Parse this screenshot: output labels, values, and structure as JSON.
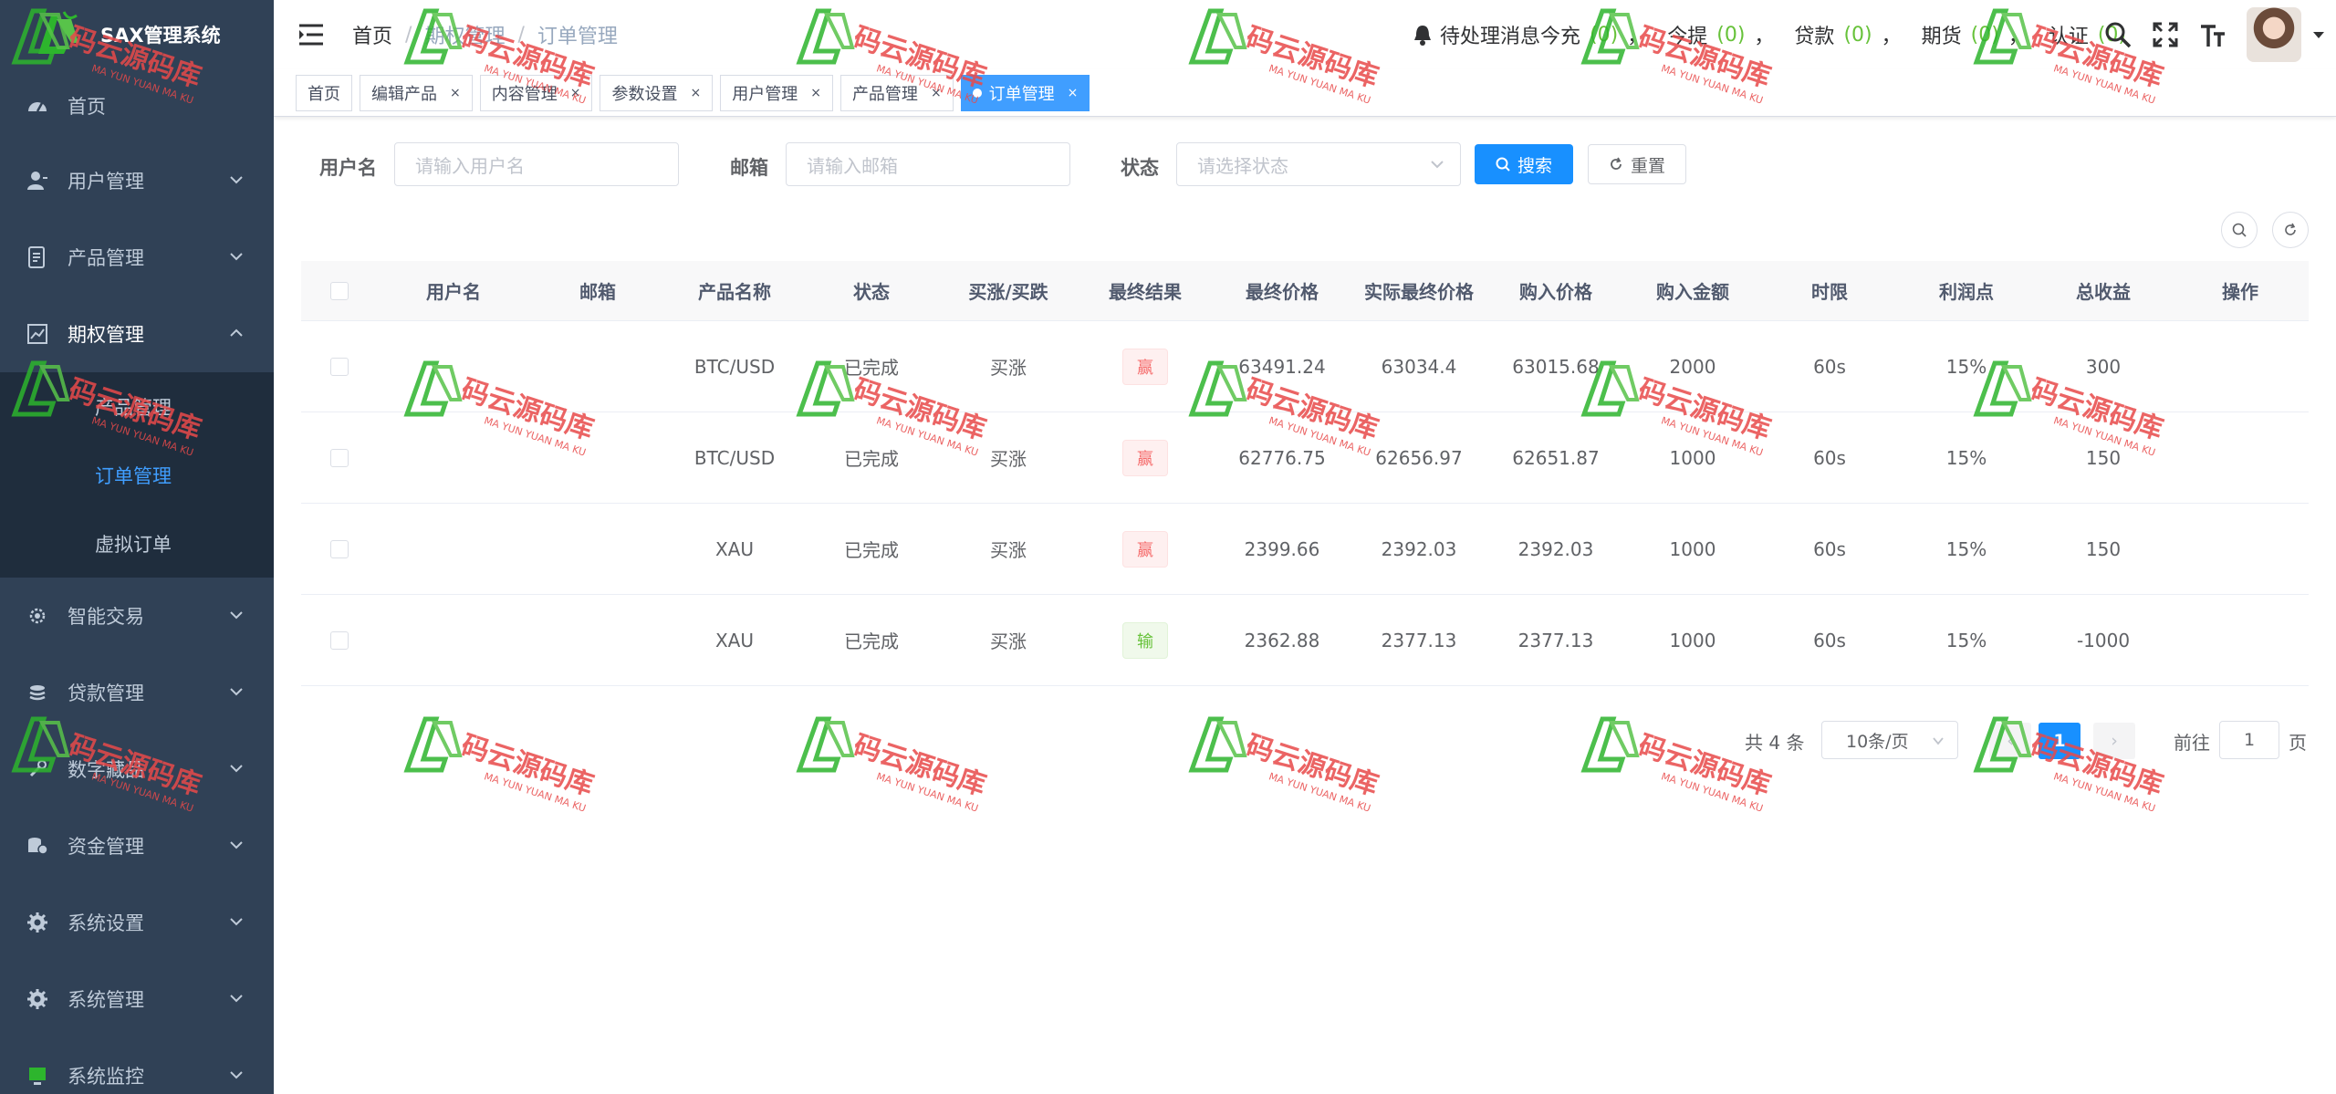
{
  "app": {
    "title": "SAX管理系统"
  },
  "sidebar": {
    "items": [
      {
        "label": "首页",
        "icon": "dashboard-icon"
      },
      {
        "label": "用户管理",
        "icon": "user-icon"
      },
      {
        "label": "产品管理",
        "icon": "document-icon"
      },
      {
        "label": "期权管理",
        "icon": "chart-icon",
        "expanded": true,
        "children": [
          {
            "label": "产品管理"
          },
          {
            "label": "订单管理",
            "active": true
          },
          {
            "label": "虚拟订单"
          }
        ]
      },
      {
        "label": "智能交易",
        "icon": "gear-icon"
      },
      {
        "label": "贷款管理",
        "icon": "stack-icon"
      },
      {
        "label": "数字藏品",
        "icon": "tool-icon"
      },
      {
        "label": "资金管理",
        "icon": "money-icon"
      },
      {
        "label": "系统设置",
        "icon": "gear-icon"
      },
      {
        "label": "系统管理",
        "icon": "gear-icon"
      },
      {
        "label": "系统监控",
        "icon": "monitor-icon"
      }
    ]
  },
  "header": {
    "breadcrumb": [
      "首页",
      "期权管理",
      "订单管理"
    ],
    "notice": {
      "label": "待处理消息",
      "items": [
        {
          "label": "今充",
          "count": "(0)"
        },
        {
          "label": "今提",
          "count": "(0)"
        },
        {
          "label": "贷款",
          "count": "(0)"
        },
        {
          "label": "期货",
          "count": "(0)"
        },
        {
          "label": "认证",
          "count": "(0)"
        }
      ],
      "separator": "，"
    }
  },
  "tags": [
    {
      "label": "首页",
      "closable": false
    },
    {
      "label": "编辑产品",
      "closable": true
    },
    {
      "label": "内容管理",
      "closable": true
    },
    {
      "label": "参数设置",
      "closable": true
    },
    {
      "label": "用户管理",
      "closable": true
    },
    {
      "label": "产品管理",
      "closable": true
    },
    {
      "label": "订单管理",
      "closable": true,
      "active": true
    }
  ],
  "close_glyph": "×",
  "search": {
    "username_label": "用户名",
    "username_placeholder": "请输入用户名",
    "email_label": "邮箱",
    "email_placeholder": "请输入邮箱",
    "status_label": "状态",
    "status_placeholder": "请选择状态",
    "search_button": "搜索",
    "reset_button": "重置"
  },
  "table": {
    "columns": [
      "用户名",
      "邮箱",
      "产品名称",
      "状态",
      "买涨/买跌",
      "最终结果",
      "最终价格",
      "实际最终价格",
      "购入价格",
      "购入金额",
      "时限",
      "利润点",
      "总收益",
      "操作"
    ],
    "rows": [
      {
        "username": "",
        "email": "",
        "product": "BTC/USD",
        "status": "已完成",
        "direction": "买涨",
        "result": "赢",
        "result_type": "win",
        "final_price": "63491.24",
        "actual_final_price": "63034.4",
        "buy_price": "63015.68",
        "amount": "2000",
        "term": "60s",
        "profit_point": "15%",
        "total_profit": "300"
      },
      {
        "username": "",
        "email": "",
        "product": "BTC/USD",
        "status": "已完成",
        "direction": "买涨",
        "result": "赢",
        "result_type": "win",
        "final_price": "62776.75",
        "actual_final_price": "62656.97",
        "buy_price": "62651.87",
        "amount": "1000",
        "term": "60s",
        "profit_point": "15%",
        "total_profit": "150"
      },
      {
        "username": "",
        "email": "",
        "product": "XAU",
        "status": "已完成",
        "direction": "买涨",
        "result": "赢",
        "result_type": "win",
        "final_price": "2399.66",
        "actual_final_price": "2392.03",
        "buy_price": "2392.03",
        "amount": "1000",
        "term": "60s",
        "profit_point": "15%",
        "total_profit": "150"
      },
      {
        "username": "",
        "email": "",
        "product": "XAU",
        "status": "已完成",
        "direction": "买涨",
        "result": "输",
        "result_type": "lose",
        "final_price": "2362.88",
        "actual_final_price": "2377.13",
        "buy_price": "2377.13",
        "amount": "1000",
        "term": "60s",
        "profit_point": "15%",
        "total_profit": "-1000"
      }
    ]
  },
  "pagination": {
    "total_text": "共 4 条",
    "page_size": "10条/页",
    "prev_glyph": "‹",
    "next_glyph": "›",
    "current_page": "1",
    "goto_prefix": "前往",
    "goto_value": "1",
    "goto_suffix": "页"
  },
  "watermark": {
    "text": "码云源码库",
    "sub": "MA YUN YUAN MA KU"
  },
  "colors": {
    "sidebar_bg": "#304156",
    "submenu_bg": "#1f2d3d",
    "accent": "#1890ff",
    "active_menu_text": "#409eff",
    "win": "#f56c6c",
    "lose": "#67c23a",
    "notice_count": "#67c23a"
  }
}
